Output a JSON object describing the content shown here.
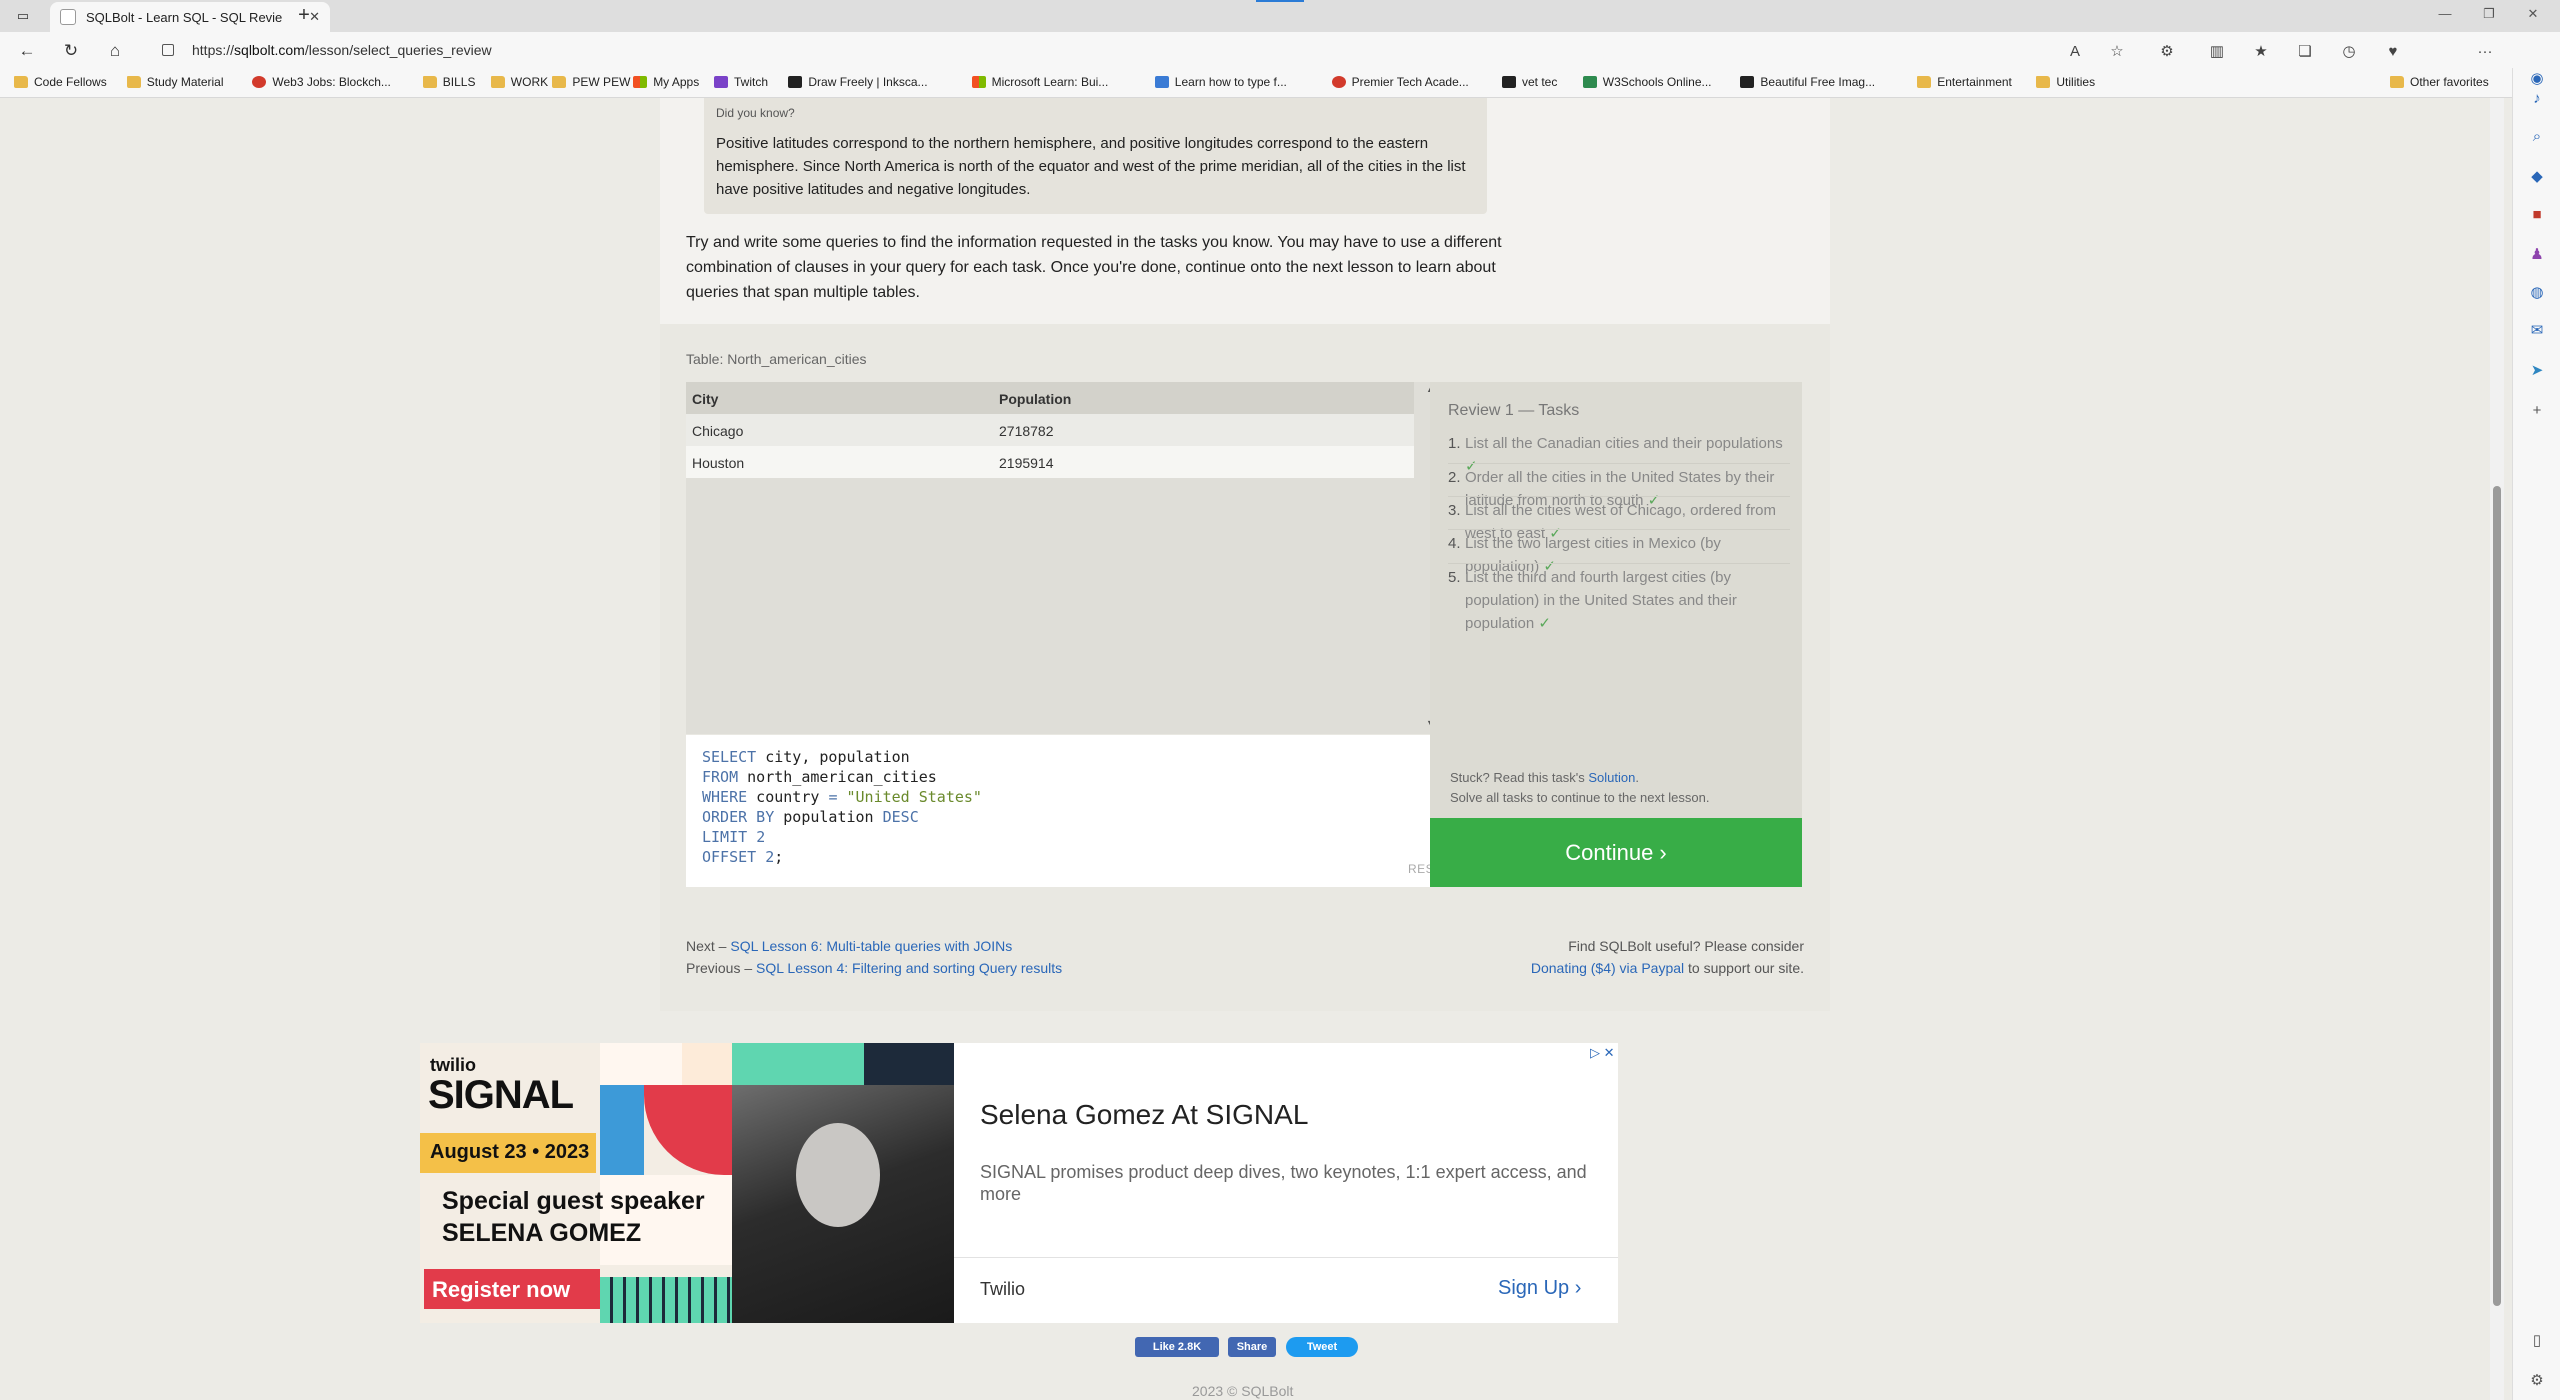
{
  "browser": {
    "tab_title": "SQLBolt - Learn SQL - SQL Revie",
    "url_prefix": "https://",
    "url_domain": "sqlbolt.com",
    "url_path": "/lesson/select_queries_review"
  },
  "bookmarks": [
    {
      "label": "Code Fellows",
      "icon": "folder"
    },
    {
      "label": "Study Material",
      "icon": "folder"
    },
    {
      "label": "Web3 Jobs: Blockch...",
      "icon": "red"
    },
    {
      "label": "BILLS",
      "icon": "folder"
    },
    {
      "label": "WORK",
      "icon": "folder"
    },
    {
      "label": "PEW PEW",
      "icon": "folder"
    },
    {
      "label": "My Apps",
      "icon": "ms"
    },
    {
      "label": "Twitch",
      "icon": "purple"
    },
    {
      "label": "Draw Freely | Inksca...",
      "icon": "black"
    },
    {
      "label": "Microsoft Learn: Bui...",
      "icon": "ms"
    },
    {
      "label": "Learn how to type f...",
      "icon": "blue"
    },
    {
      "label": "Premier Tech Acade...",
      "icon": "red"
    },
    {
      "label": "vet tec",
      "icon": "black"
    },
    {
      "label": "W3Schools Online...",
      "icon": "green"
    },
    {
      "label": "Beautiful Free Imag...",
      "icon": "black"
    },
    {
      "label": "Entertainment",
      "icon": "folder"
    },
    {
      "label": "Utilities",
      "icon": "folder"
    }
  ],
  "other_favorites": "Other favorites",
  "lesson": {
    "did_you_know_title": "Did you know?",
    "did_you_know_text": "Positive latitudes correspond to the northern hemisphere, and positive longitudes correspond to the eastern hemisphere. Since North America is north of the equator and west of the prime meridian, all of the cities in the list have positive latitudes and negative longitudes.",
    "intro": "Try and write some queries to find the information requested in the tasks you know. You may have to use a different combination of clauses in your query for each task. Once you're done, continue onto the next lesson to learn about queries that span multiple tables."
  },
  "table": {
    "label": "Table: North_american_cities",
    "columns": [
      "City",
      "Population"
    ],
    "rows": [
      [
        "Chicago",
        "2718782"
      ],
      [
        "Houston",
        "2195914"
      ]
    ]
  },
  "editor": {
    "lines": [
      [
        {
          "t": "SELECT",
          "c": "kw"
        },
        {
          "t": " city, population",
          "c": "id"
        }
      ],
      [
        {
          "t": "FROM",
          "c": "kw"
        },
        {
          "t": " north_american_cities",
          "c": "id"
        }
      ],
      [
        {
          "t": "WHERE",
          "c": "kw"
        },
        {
          "t": " country ",
          "c": "id"
        },
        {
          "t": "=",
          "c": "kw"
        },
        {
          "t": " ",
          "c": "id"
        },
        {
          "t": "\"United States\"",
          "c": "str"
        }
      ],
      [
        {
          "t": "ORDER BY",
          "c": "kw"
        },
        {
          "t": " population ",
          "c": "id"
        },
        {
          "t": "DESC",
          "c": "kw"
        }
      ],
      [
        {
          "t": "LIMIT",
          "c": "kw"
        },
        {
          "t": " ",
          "c": "id"
        },
        {
          "t": "2",
          "c": "num"
        }
      ],
      [
        {
          "t": "OFFSET",
          "c": "kw"
        },
        {
          "t": " ",
          "c": "id"
        },
        {
          "t": "2",
          "c": "num"
        },
        {
          "t": ";",
          "c": "id"
        }
      ]
    ],
    "reset_label": "RESET"
  },
  "tasks": {
    "title": "Review 1 — Tasks",
    "items": [
      {
        "num": "1.",
        "text": "List all the Canadian cities and their populations",
        "check": "✓"
      },
      {
        "num": "2.",
        "text": "Order all the cities in the United States by their latitude from north to south",
        "check": "✓"
      },
      {
        "num": "3.",
        "text": "List all the cities west of Chicago, ordered from west to east",
        "check": "✓"
      },
      {
        "num": "4.",
        "text": "List the two largest cities in Mexico (by population)",
        "check": "✓"
      },
      {
        "num": "5.",
        "text": "List the third and fourth largest cities (by population) in the United States and their population",
        "check": "✓"
      }
    ],
    "stuck_prefix": "Stuck? Read this task's ",
    "solution_link": "Solution",
    "solve_all": "Solve all tasks to continue to the next lesson.",
    "continue_label": "Continue ›"
  },
  "nav": {
    "next_prefix": "Next – ",
    "next_link": "SQL Lesson 6: Multi-table queries with JOINs",
    "previous_prefix": "Previous – ",
    "previous_link": "SQL Lesson 4: Filtering and sorting Query results",
    "donate_line1": "Find SQLBolt useful? Please consider",
    "donate_link": "Donating ($4) via Paypal",
    "donate_suffix": " to support our site."
  },
  "ad": {
    "twilio": "twilio",
    "signal": "SIGNAL",
    "date": "August 23 • 2023",
    "guest_line1": "Special guest speaker",
    "guest_line2": "SELENA GOMEZ",
    "register": "Register now",
    "title": "Selena Gomez At SIGNAL",
    "description": "SIGNAL promises product deep dives, two keynotes, 1:1 expert access, and more",
    "brand": "Twilio",
    "cta": "Sign Up",
    "choices": "▷ ✕"
  },
  "social": {
    "like": "Like 2.8K",
    "share": "Share",
    "tweet": "Tweet"
  },
  "footer": "2023 © SQLBolt",
  "colors": {
    "continue_green": "#38ad47",
    "link_blue": "#2a67b8",
    "check_green": "#5aa85a"
  }
}
